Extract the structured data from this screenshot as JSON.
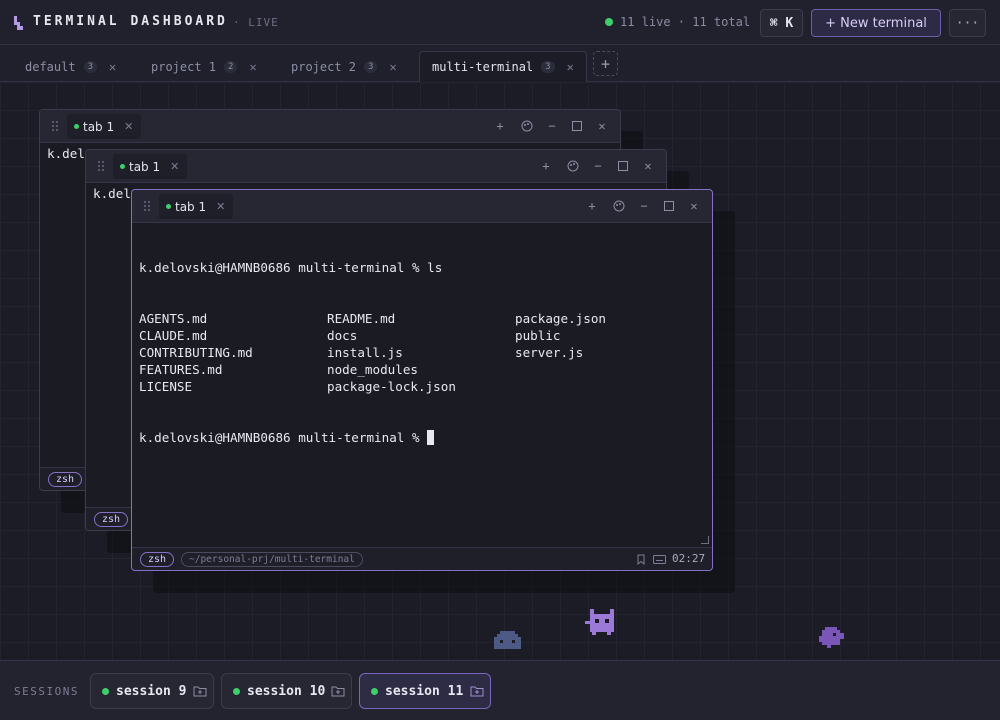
{
  "header": {
    "title": "TERMINAL DASHBOARD",
    "live_label": "· LIVE",
    "live_count": "11 live · 11 total",
    "shortcut": "⌘ K",
    "new_terminal_label": "+ New terminal",
    "more_label": "···"
  },
  "project_tabs": [
    {
      "label": "default",
      "count": "3",
      "active": false
    },
    {
      "label": "project 1",
      "count": "2",
      "active": false
    },
    {
      "label": "project 2",
      "count": "3",
      "active": false
    },
    {
      "label": "multi-terminal",
      "count": "3",
      "active": true
    }
  ],
  "add_tab_label": "+",
  "windows": {
    "back": {
      "tab": "tab 1",
      "prompt": "k.delo",
      "shell": "zsh"
    },
    "middle": {
      "tab": "tab 1",
      "prompt": "k.delo",
      "shell": "zsh"
    },
    "front": {
      "tab": "tab 1",
      "command_line": "k.delovski@HAMNB0686 multi-terminal % ls",
      "files": [
        [
          "AGENTS.md",
          "README.md",
          "package.json"
        ],
        [
          "CLAUDE.md",
          "docs",
          "public"
        ],
        [
          "CONTRIBUTING.md",
          "install.js",
          "server.js"
        ],
        [
          "FEATURES.md",
          "node_modules",
          ""
        ],
        [
          "LICENSE",
          "package-lock.json",
          ""
        ]
      ],
      "prompt_line": "k.delovski@HAMNB0686 multi-terminal % ",
      "shell": "zsh",
      "path": "~/personal-prj/multi-terminal",
      "time": "02:27"
    }
  },
  "sessions": {
    "label": "SESSIONS",
    "items": [
      {
        "label": "session 9",
        "active": false
      },
      {
        "label": "session 10",
        "active": false
      },
      {
        "label": "session 11",
        "active": true
      }
    ]
  },
  "colors": {
    "accent": "#8770c8",
    "live": "#3ecf6a",
    "background": "#1b1c25"
  }
}
